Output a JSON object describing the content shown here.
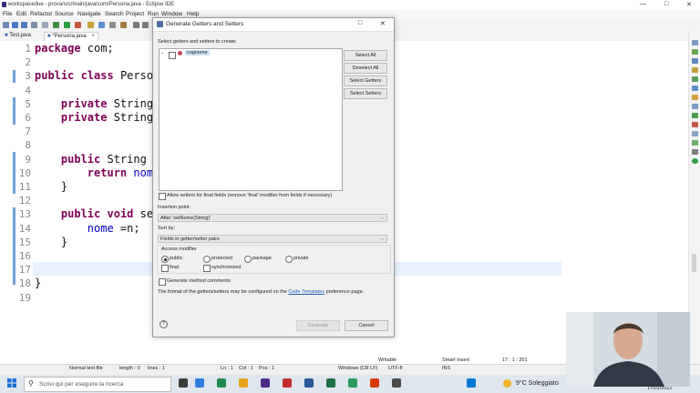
{
  "window": {
    "title": "workspacedue - prova/src/main/java/com/Persona.java - Eclipse IDE"
  },
  "menu": [
    "File",
    "Edit",
    "Refactor",
    "Source",
    "Navigate",
    "Search",
    "Project",
    "Run",
    "Window",
    "Help"
  ],
  "tabs": [
    {
      "label": "Test.java"
    },
    {
      "label": "*Persona.java"
    }
  ],
  "editor": {
    "lines": [
      {
        "n": "1",
        "text": "package com;"
      },
      {
        "n": "2",
        "text": ""
      },
      {
        "n": "3",
        "text": "public class Perso"
      },
      {
        "n": "4",
        "text": ""
      },
      {
        "n": "5",
        "text": "    private String"
      },
      {
        "n": "6",
        "text": "    private String"
      },
      {
        "n": "7",
        "text": ""
      },
      {
        "n": "8",
        "text": ""
      },
      {
        "n": "9",
        "text": "    public String"
      },
      {
        "n": "10",
        "text": "        return nom"
      },
      {
        "n": "11",
        "text": "    }"
      },
      {
        "n": "12",
        "text": ""
      },
      {
        "n": "13",
        "text": "    public void se"
      },
      {
        "n": "14",
        "text": "        nome =n;"
      },
      {
        "n": "15",
        "text": "    }"
      },
      {
        "n": "16",
        "text": ""
      },
      {
        "n": "17",
        "text": ""
      },
      {
        "n": "18",
        "text": "}"
      },
      {
        "n": "19",
        "text": ""
      }
    ]
  },
  "dialog": {
    "title": "Generate Getters and Setters",
    "prompt": "Select getters and setters to create:",
    "tree_item": "cognome",
    "buttons": {
      "select_all": "Select All",
      "deselect_all": "Deselect All",
      "select_getters": "Select Getters",
      "select_setters": "Select Setters"
    },
    "allow_setters_final": "Allow setters for final fields (remove 'final' modifier from fields if necessary)",
    "insertion_point_label": "Insertion point:",
    "insertion_point_value": "After 'setNome(String)'",
    "sort_by_label": "Sort by:",
    "sort_by_value": "Fields in getter/setter pairs",
    "access_modifier_label": "Access modifier",
    "access": {
      "public": "public",
      "protected": "protected",
      "package": "package",
      "private": "private"
    },
    "final_label": "final",
    "synchronized_label": "synchronized",
    "generate_comments": "Generate method comments",
    "info_text": "The format of the getters/setters may be configured on the",
    "info_link": "Code Templates",
    "info_tail": "preference page.",
    "generate_button": "Generate",
    "cancel_button": "Cancel",
    "help_glyph": "?"
  },
  "statusbar": {
    "file_type": "Normal text file",
    "length": "length : 0",
    "lines": "lines : 1",
    "ln": "Ln : 1",
    "col": "Col : 1",
    "pos": "Pos : 1",
    "eol": "Windows (CR LF)",
    "encoding": "UTF-8",
    "writable": "Writable",
    "insert_mode": "Smart Insert",
    "ins": "INS",
    "position": "17 : 1 : 201"
  },
  "taskbar": {
    "search_placeholder": "Scrivi qui per eseguire la ricerca",
    "weather": "9°C  Soleggiato",
    "date": "17/01/2022"
  },
  "colors": {
    "keyword": "#7f0055",
    "field": "#0000c0",
    "current_line": "#e8f2fe",
    "selection": "#cce0f7",
    "link": "#1a5fb4"
  }
}
